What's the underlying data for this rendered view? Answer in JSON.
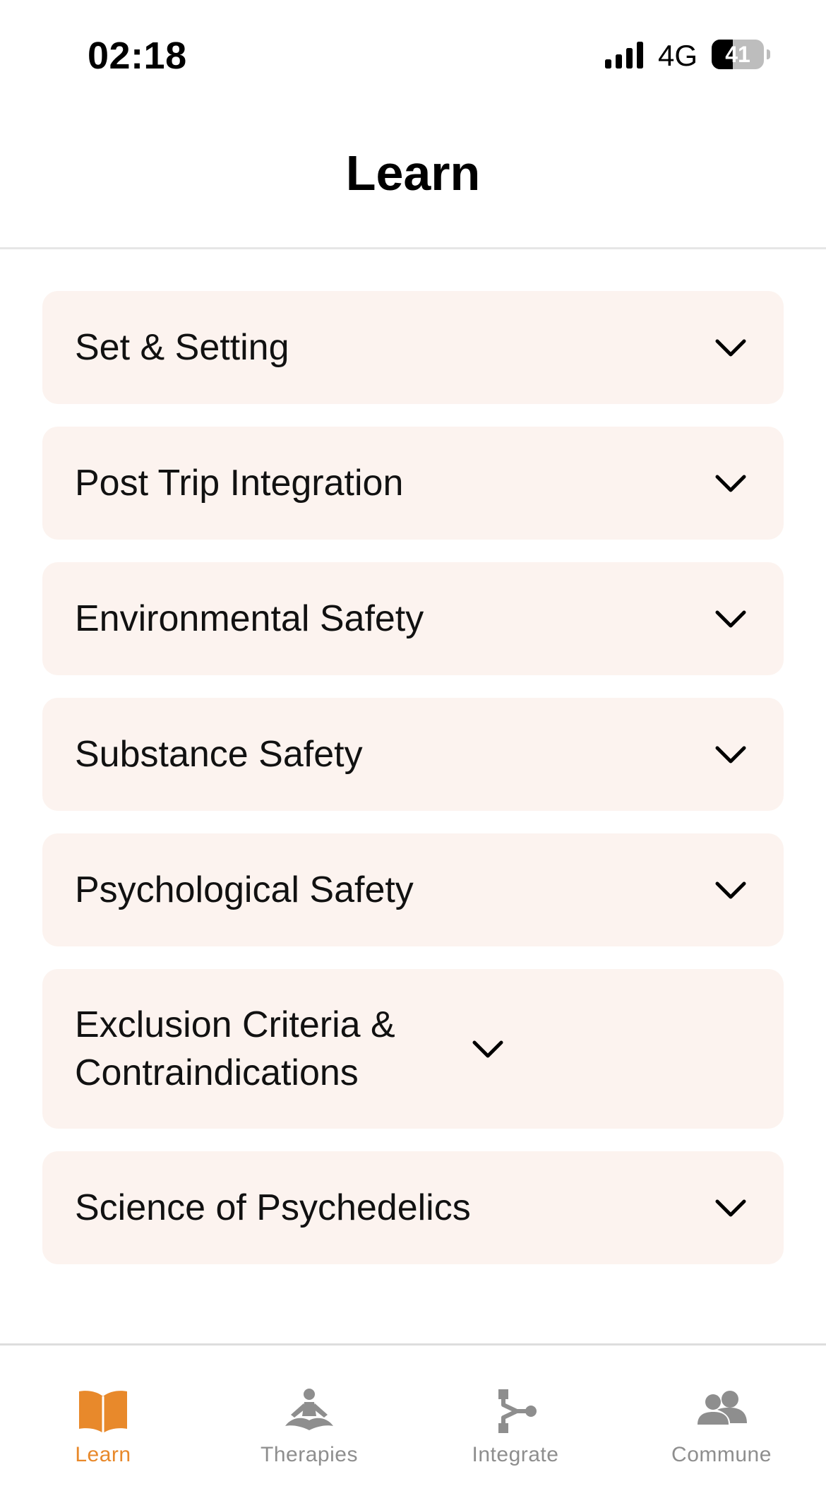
{
  "status_bar": {
    "time": "02:18",
    "network": "4G",
    "battery_level": "41",
    "battery_fraction": 0.41
  },
  "header": {
    "title": "Learn"
  },
  "sections": [
    {
      "label": "Set & Setting",
      "icon": "chevron-down-icon"
    },
    {
      "label": "Post Trip Integration",
      "icon": "chevron-down-icon"
    },
    {
      "label": "Environmental Safety",
      "icon": "chevron-down-icon"
    },
    {
      "label": "Substance Safety",
      "icon": "chevron-down-icon"
    },
    {
      "label": "Psychological Safety",
      "icon": "chevron-down-icon"
    },
    {
      "label": "Exclusion Criteria & Contraindications",
      "icon": "chevron-down-icon"
    },
    {
      "label": "Science of Psychedelics",
      "icon": "chevron-down-icon"
    }
  ],
  "tabs": [
    {
      "label": "Learn",
      "icon": "book-icon",
      "active": true
    },
    {
      "label": "Therapies",
      "icon": "meditation-icon",
      "active": false
    },
    {
      "label": "Integrate",
      "icon": "branch-icon",
      "active": false
    },
    {
      "label": "Commune",
      "icon": "people-icon",
      "active": false
    }
  ],
  "colors": {
    "accent": "#e8892b",
    "inactive": "#8e8e8e",
    "card_background": "#fcf3ef"
  }
}
